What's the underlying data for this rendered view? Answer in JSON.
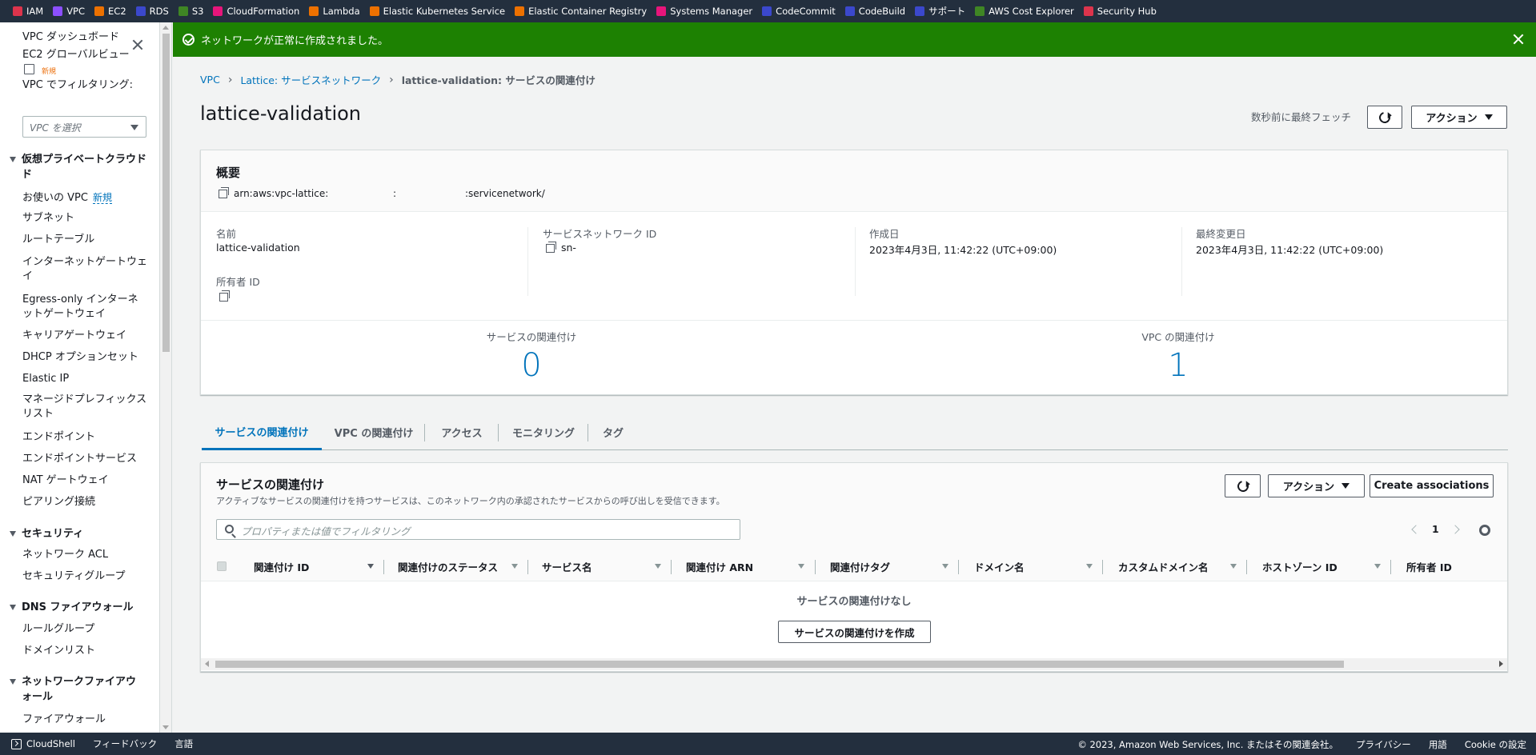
{
  "favorites": [
    {
      "label": "IAM",
      "color": "#dd344c"
    },
    {
      "label": "VPC",
      "color": "#8c4fff"
    },
    {
      "label": "EC2",
      "color": "#ed7100"
    },
    {
      "label": "RDS",
      "color": "#3b48cc"
    },
    {
      "label": "S3",
      "color": "#3f8624"
    },
    {
      "label": "CloudFormation",
      "color": "#e7157b"
    },
    {
      "label": "Lambda",
      "color": "#ed7100"
    },
    {
      "label": "Elastic Kubernetes Service",
      "color": "#ed7100"
    },
    {
      "label": "Elastic Container Registry",
      "color": "#ed7100"
    },
    {
      "label": "Systems Manager",
      "color": "#e7157b"
    },
    {
      "label": "CodeCommit",
      "color": "#3b48cc"
    },
    {
      "label": "CodeBuild",
      "color": "#3b48cc"
    },
    {
      "label": "サポート",
      "color": "#3b48cc"
    },
    {
      "label": "AWS Cost Explorer",
      "color": "#3f8624"
    },
    {
      "label": "Security Hub",
      "color": "#dd344c"
    }
  ],
  "sidebar": {
    "dashboard": "VPC ダッシュボード",
    "global_view": "EC2 グローバルビュー",
    "global_view_badge": "新規",
    "filter_label": "VPC でフィルタリング:",
    "filter_placeholder": "VPC を選択",
    "section_vpc": "仮想プライベートクラウド",
    "section_vpc_line2": "ド",
    "your_vpcs": "お使いの VPC",
    "your_vpcs_badge": "新規",
    "subnets": "サブネット",
    "route_tables": "ルートテーブル",
    "igw_1": "インターネットゲートウェ",
    "igw_2": "イ",
    "egress_1": "Egress-only インターネ",
    "egress_2": "ットゲートウェイ",
    "carrier": "キャリアゲートウェイ",
    "dhcp": "DHCP オプションセット",
    "eip": "Elastic IP",
    "prefix_1": "マネージドプレフィックス",
    "prefix_2": "リスト",
    "endpoints": "エンドポイント",
    "endpoint_services": "エンドポイントサービス",
    "nat": "NAT ゲートウェイ",
    "peering": "ピアリング接続",
    "section_security": "セキュリティ",
    "nacl": "ネットワーク ACL",
    "sg": "セキュリティグループ",
    "section_dns": "DNS ファイアウォール",
    "rule_groups": "ルールグループ",
    "domain_lists": "ドメインリスト",
    "section_nfw_1": "ネットワークファイアウ",
    "section_nfw_2": "ォール",
    "firewalls": "ファイアウォール"
  },
  "flash": {
    "message": "ネットワークが正常に作成されました。",
    "color": "#1d8102"
  },
  "breadcrumb": {
    "root": "VPC",
    "parent": "Lattice: サービスネットワーク",
    "current": "lattice-validation: サービスの関連付け"
  },
  "header": {
    "title": "lattice-validation",
    "fetched": "数秒前に最終フェッチ",
    "actions": "アクション"
  },
  "summary": {
    "title": "概要",
    "arn_prefix": "arn:aws:vpc-lattice:",
    "arn_colon": ":",
    "arn_suffix": ":servicenetwork/",
    "name_label": "名前",
    "name_value": "lattice-validation",
    "owner_label": "所有者 ID",
    "sn_id_label": "サービスネットワーク ID",
    "sn_id_value": "sn-",
    "created_label": "作成日",
    "created_value": "2023年4月3日, 11:42:22 (UTC+09:00)",
    "modified_label": "最終変更日",
    "modified_value": "2023年4月3日, 11:42:22 (UTC+09:00)",
    "svc_assoc_label": "サービスの関連付け",
    "svc_assoc_count": "0",
    "vpc_assoc_label": "VPC の関連付け",
    "vpc_assoc_count": "1"
  },
  "tabs": [
    "サービスの関連付け",
    "VPC の関連付け",
    "アクセス",
    "モニタリング",
    "タグ"
  ],
  "table": {
    "title": "サービスの関連付け",
    "description": "アクティブなサービスの関連付けを持つサービスは、このネットワーク内の承認されたサービスからの呼び出しを受信できます。",
    "actions": "アクション",
    "create": "Create associations",
    "filter_placeholder": "プロパティまたは値でフィルタリング",
    "page": "1",
    "columns": [
      "関連付け ID",
      "関連付けのステータス",
      "サービス名",
      "関連付け ARN",
      "関連付けタグ",
      "ドメイン名",
      "カスタムドメイン名",
      "ホストゾーン ID",
      "所有者 ID"
    ],
    "empty_text": "サービスの関連付けなし",
    "empty_button": "サービスの関連付けを作成"
  },
  "footer": {
    "cloudshell": "CloudShell",
    "feedback": "フィードバック",
    "language": "言語",
    "copyright": "© 2023, Amazon Web Services, Inc. またはその関連会社。",
    "privacy": "プライバシー",
    "terms": "用語",
    "cookies": "Cookie の設定"
  }
}
